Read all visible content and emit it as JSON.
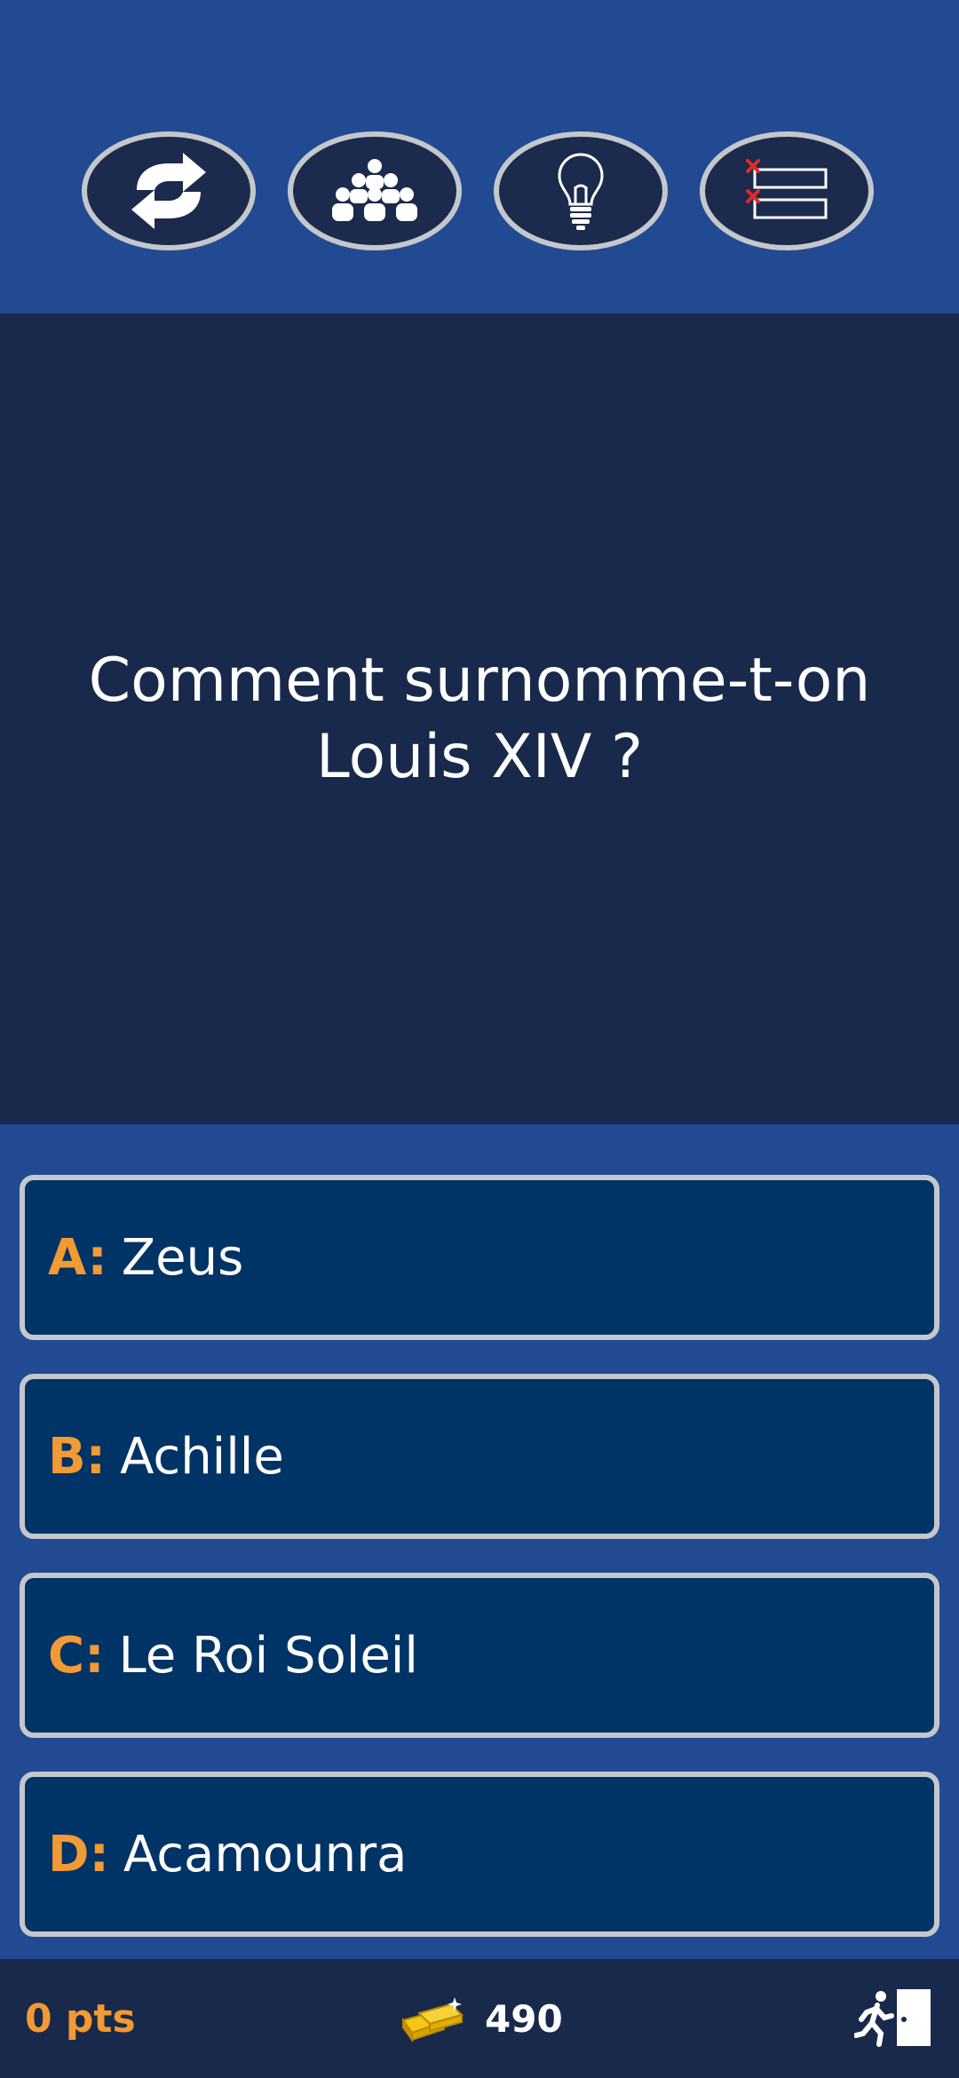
{
  "lifelines": [
    {
      "name": "switch-question",
      "icon": "refresh-icon"
    },
    {
      "name": "ask-audience",
      "icon": "audience-icon"
    },
    {
      "name": "hint",
      "icon": "lightbulb-icon"
    },
    {
      "name": "fifty-fifty",
      "icon": "remove-answers-icon"
    }
  ],
  "question": {
    "text": "Comment surnomme-t-on Louis XIV ?"
  },
  "answers": [
    {
      "letter": "A:",
      "text": "Zeus"
    },
    {
      "letter": "B:",
      "text": "Achille"
    },
    {
      "letter": "C:",
      "text": "Le Roi Soleil"
    },
    {
      "letter": "D:",
      "text": "Acamounra"
    }
  ],
  "footer": {
    "points": "0 pts",
    "coins": "490",
    "coins_icon": "gold-bars-icon",
    "exit_icon": "exit-door-icon"
  },
  "colors": {
    "background": "#224a92",
    "panel": "#19294b",
    "answer_fill": "#003366",
    "border": "#c4c7cc",
    "accent": "#f29a33",
    "text": "#ffffff"
  }
}
